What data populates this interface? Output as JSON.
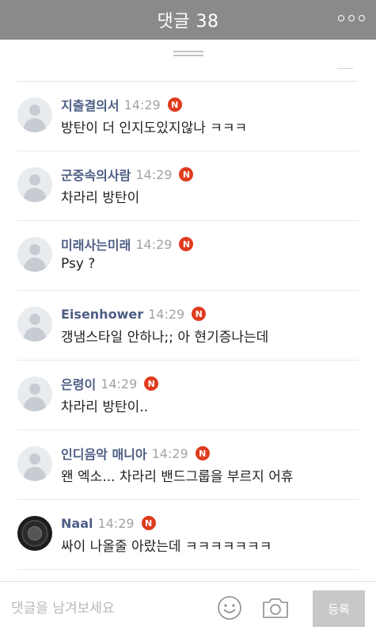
{
  "header": {
    "title": "댓글 38",
    "more_icon": "more-dots-icon"
  },
  "colors": {
    "header_bg": "#8a8a8a",
    "nickname": "#4d5e85",
    "badge": "#e03b1e",
    "submit_bg": "#c8c8c8"
  },
  "comments": [
    {
      "nickname": "지출결의서",
      "time": "14:29",
      "badge": "N",
      "text": "방탄이 더 인지도있지않나 ㅋㅋㅋ",
      "avatar": "default-avatar-icon"
    },
    {
      "nickname": "군중속의사람",
      "time": "14:29",
      "badge": "N",
      "text": "차라리 방탄이",
      "avatar": "default-avatar-icon"
    },
    {
      "nickname": "미래사는미래",
      "time": "14:29",
      "badge": "N",
      "text": "Psy ?",
      "avatar": "default-avatar-icon"
    },
    {
      "nickname": "Eisenhower",
      "time": "14:29",
      "badge": "N",
      "text": "갱냄스타일 안하나;; 아 현기증나는데",
      "avatar": "default-avatar-icon"
    },
    {
      "nickname": "은령이",
      "time": "14:29",
      "badge": "N",
      "text": "차라리 방탄이..",
      "avatar": "default-avatar-icon"
    },
    {
      "nickname": "인디음악 매니아",
      "time": "14:29",
      "badge": "N",
      "text": "왠 엑소... 차라리 밴드그룹을 부르지 어휴",
      "avatar": "default-avatar-icon"
    },
    {
      "nickname": "Naal",
      "time": "14:29",
      "badge": "N",
      "text": "싸이 나올줄 아랐는데 ㅋㅋㅋㅋㅋㅋㅋ",
      "avatar": "profile-photo"
    }
  ],
  "composer": {
    "placeholder": "댓글을 남겨보세요",
    "emoji_icon": "smiley-icon",
    "camera_icon": "camera-icon",
    "submit_label": "등록"
  }
}
